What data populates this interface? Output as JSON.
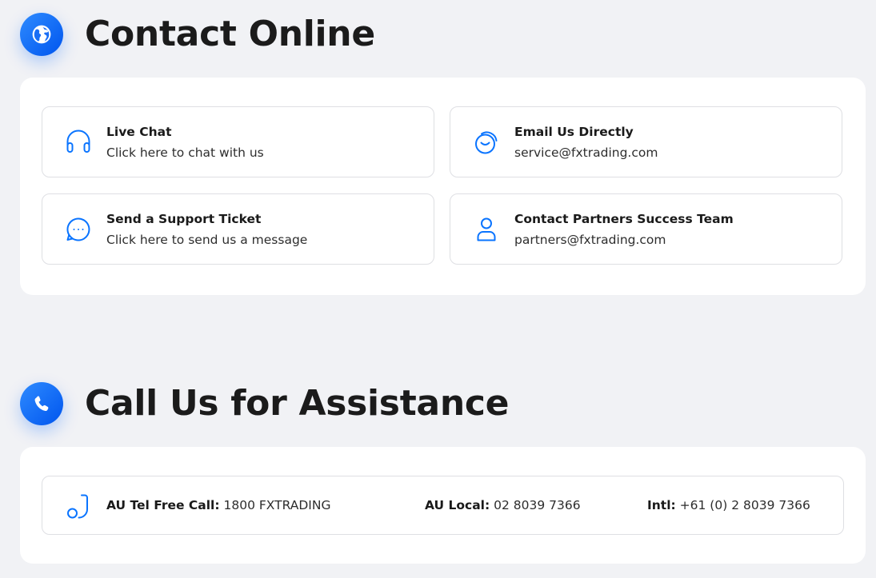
{
  "colors": {
    "accent": "#0a74ff",
    "page_bg": "#f1f2f5",
    "panel_bg": "#ffffff",
    "card_border": "#dedfe3",
    "heading": "#1b1b1b"
  },
  "contact_online": {
    "title": "Contact Online",
    "icon": "globe-icon",
    "cards": [
      {
        "title": "Live Chat",
        "subtitle": "Click here to chat with us",
        "icon": "headset-icon"
      },
      {
        "title": "Email Us Directly",
        "subtitle": "service@fxtrading.com",
        "icon": "email-bubble-icon"
      },
      {
        "title": "Send a Support Ticket",
        "subtitle": "Click here to send us a message",
        "icon": "chat-dots-icon"
      },
      {
        "title": "Contact Partners Success Team",
        "subtitle": "partners@fxtrading.com",
        "icon": "user-icon"
      }
    ]
  },
  "call_us": {
    "title": "Call Us for Assistance",
    "icon": "phone-icon",
    "row_icon": "handset-icon",
    "numbers": [
      {
        "label": "AU Tel Free Call:",
        "value": "1800 FXTRADING"
      },
      {
        "label": "AU Local:",
        "value": "02 8039 7366"
      },
      {
        "label": "Intl:",
        "value": "+61 (0) 2 8039 7366"
      }
    ]
  }
}
